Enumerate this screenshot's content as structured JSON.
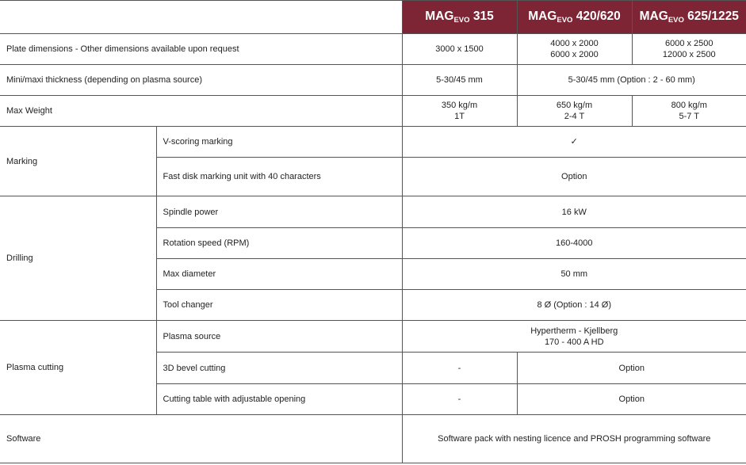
{
  "header": {
    "models": [
      {
        "prefix": "MAG",
        "sub": "EVO",
        "suffix": " 315"
      },
      {
        "prefix": "MAG",
        "sub": "EVO",
        "suffix": " 420/620"
      },
      {
        "prefix": "MAG",
        "sub": "EVO",
        "suffix": " 625/1225"
      }
    ]
  },
  "rows": {
    "plate": {
      "label": "Plate dimensions - Other dimensions available upon request",
      "m315": "3000 x 1500",
      "m420": [
        "4000 x 2000",
        "6000 x 2000"
      ],
      "m625": [
        "6000 x 2500",
        "12000 x 2500"
      ]
    },
    "thickness": {
      "label": "Mini/maxi thickness (depending on plasma source)",
      "m315": "5-30/45 mm",
      "m420_625": "5-30/45 mm (Option : 2 - 60 mm)"
    },
    "weight": {
      "label": "Max Weight",
      "m315": [
        "350 kg/m",
        "1T"
      ],
      "m420": [
        "650 kg/m",
        "2-4 T"
      ],
      "m625": [
        "800 kg/m",
        "5-7 T"
      ]
    },
    "marking": {
      "group": "Marking",
      "items": [
        {
          "label": "V-scoring marking",
          "value": "✓"
        },
        {
          "label": "Fast disk marking unit with 40 characters",
          "value": "Option"
        }
      ]
    },
    "drilling": {
      "group": "Drilling",
      "items": [
        {
          "label": "Spindle power",
          "value": "16 kW"
        },
        {
          "label": "Rotation speed (RPM)",
          "value": "160-4000"
        },
        {
          "label": "Max diameter",
          "value": "50 mm"
        },
        {
          "label": "Tool changer",
          "value": "8 Ø (Option : 14 Ø)"
        }
      ]
    },
    "plasma": {
      "group": "Plasma cutting",
      "source_label": "Plasma source",
      "source_value": [
        "Hypertherm - Kjellberg",
        "170 - 400 A HD"
      ],
      "bevel_label": "3D bevel cutting",
      "bevel_m315": "-",
      "bevel_other": "Option",
      "table_label": "Cutting table with adjustable opening",
      "table_m315": "-",
      "table_other": "Option"
    },
    "software": {
      "label": "Software",
      "value": "Software pack with nesting licence and PROSH programming software"
    }
  }
}
